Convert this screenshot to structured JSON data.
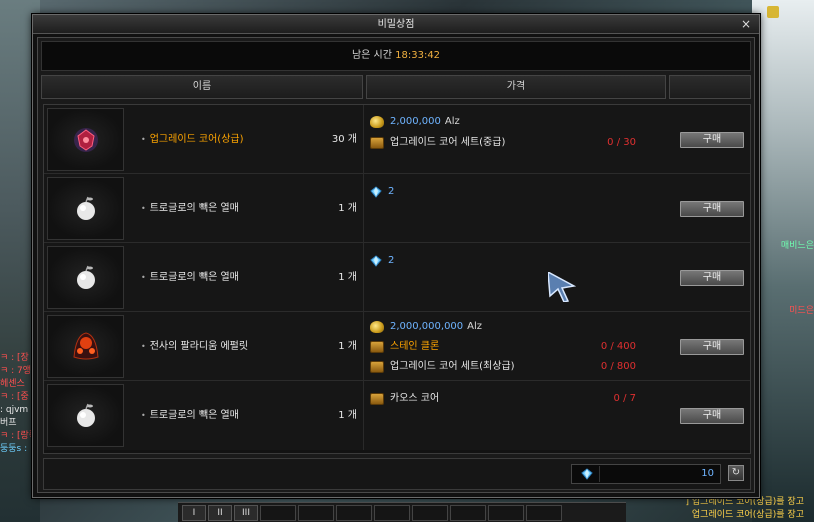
{
  "window": {
    "title": "비밀상점",
    "close_label": "×",
    "timer_label": "남은 시간",
    "timer_value": "18:33:42"
  },
  "headers": {
    "name": "이름",
    "price": "가격"
  },
  "items": [
    {
      "name": "업그레이드 코어(상급)",
      "qty": "30 개",
      "name_color": "#ffa500",
      "price_lines": [
        {
          "icon": "coin-icon",
          "value": "2,000,000",
          "unit": "Alz"
        },
        {
          "icon": "chest-icon",
          "name": "업그레이드 코어 세트(중급)",
          "count": "0 / 30"
        }
      ],
      "buy_label": "구매"
    },
    {
      "name": "트로글로의 빽은 열매",
      "qty": "1 개",
      "price_lines": [
        {
          "icon": "gem-icon",
          "value": "2"
        }
      ],
      "buy_label": "구매"
    },
    {
      "name": "트로글로의 빽은 열매",
      "qty": "1 개",
      "price_lines": [
        {
          "icon": "gem-icon",
          "value": "2"
        }
      ],
      "buy_label": "구매"
    },
    {
      "name": "전사의 팔라디움 에펄릿",
      "qty": "1 개",
      "price_lines": [
        {
          "icon": "coin-icon",
          "value": "2,000,000,000",
          "unit": "Alz"
        },
        {
          "icon": "chest-icon",
          "name": "스테인 클론",
          "count": "0 / 400",
          "name_color": "#ffa500"
        },
        {
          "icon": "chest-icon",
          "name": "업그레이드 코어 세트(최상급)",
          "count": "0 / 800"
        }
      ],
      "buy_label": "구매"
    },
    {
      "name": "트로글로의 빽은 열매",
      "qty": "1 개",
      "price_lines": [
        {
          "icon": "chest-icon",
          "name": "카오스 코어",
          "count": "0 / 7"
        }
      ],
      "buy_label": "구매"
    }
  ],
  "footer": {
    "currency_value": "10",
    "refresh_label": "↻"
  },
  "background": {
    "chat_left": [
      {
        "text": "ㅋ : [장",
        "color": "#ff5050"
      },
      {
        "text": "ㅋ : 7앵",
        "color": "#ff5050"
      },
      {
        "text": "헤센스",
        "color": "#ff5050"
      },
      {
        "text": "ㅋ : [중",
        "color": "#ff5050"
      },
      {
        "text": ": qjvm",
        "color": "#e8e8e8"
      },
      {
        "text": "버프",
        "color": "#e8e8e8"
      },
      {
        "text": "ㅋ : [랑쪽",
        "color": "#ff5050"
      },
      {
        "text": "",
        "color": "#e8e8e8"
      },
      {
        "text": "둥둥s :",
        "color": "#6fd0ff"
      }
    ],
    "chat_right": [
      {
        "text": "매비느은",
        "color": "#6fffb0"
      },
      {
        "text": "",
        "color": "#e8e8e8"
      },
      {
        "text": "",
        "color": "#e8e8e8"
      },
      {
        "text": "",
        "color": "#e8e8e8"
      },
      {
        "text": "",
        "color": "#e8e8e8"
      },
      {
        "text": "미드은",
        "color": "#ff5050"
      }
    ],
    "bottom_right": [
      "] 업그레이드 코어(상급)를 장고",
      "업그레이드 코어(상급)를 장고"
    ],
    "hotbar": [
      "I",
      "II",
      "III"
    ]
  },
  "colors": {
    "accent_orange": "#ffa500",
    "alz_blue": "#6fb4ff",
    "count_red": "#e03030"
  }
}
